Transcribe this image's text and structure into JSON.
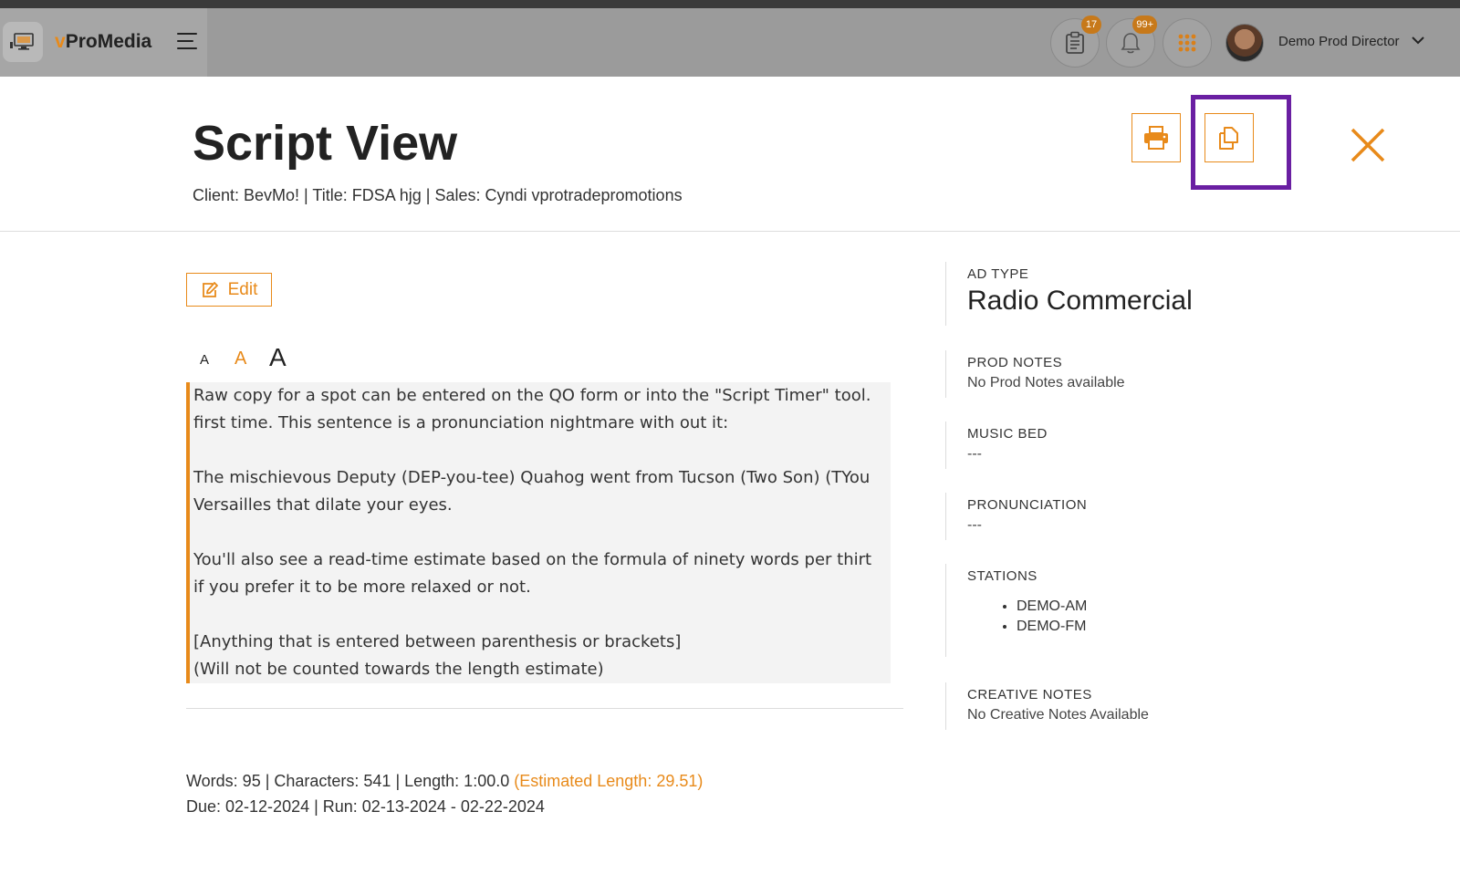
{
  "app": {
    "name_prefix": "v",
    "name_rest": "ProMedia",
    "tasks_badge": "17",
    "notifications_badge": "99+",
    "user_name": "Demo Prod Director"
  },
  "header": {
    "title": "Script View",
    "subtitle": "Client: BevMo! | Title: FDSA hjg | Sales: Cyndi vprotradepromotions"
  },
  "toolbar": {
    "edit_label": "Edit",
    "font_small": "A",
    "font_medium": "A",
    "font_large": "A"
  },
  "script": {
    "lines": [
      "Raw copy for a spot can be entered on the QO form or into the \"Script Timer\" tool.",
      "first time. This sentence is a pronunciation nightmare with out it:",
      "",
      "The mischievous Deputy (DEP-you-tee) Quahog went from Tucson (Two Son) (TYou",
      "Versailles that dilate your eyes.",
      "",
      "You'll also see a read-time estimate based on the formula of ninety words per thirt",
      "if you prefer it to be more relaxed or not.",
      "",
      "[Anything that is entered between parenthesis or brackets]",
      "(Will not be counted towards the length estimate)"
    ]
  },
  "stats": {
    "counts": "Words: 95 | Characters: 541 | Length: 1:00.0 ",
    "estimated": "(Estimated Length: 29.51)",
    "dates": "Due: 02-12-2024 | Run: 02-13-2024 - 02-22-2024"
  },
  "sidebar": {
    "ad_type_label": "AD TYPE",
    "ad_type_value": "Radio Commercial",
    "prod_notes_label": "PROD NOTES",
    "prod_notes_value": "No Prod Notes available",
    "music_bed_label": "MUSIC BED",
    "music_bed_value": "---",
    "pronunciation_label": "PRONUNCIATION",
    "pronunciation_value": "---",
    "stations_label": "STATIONS",
    "stations": [
      "DEMO-AM",
      "DEMO-FM"
    ],
    "creative_notes_label": "CREATIVE NOTES",
    "creative_notes_value": "No Creative Notes Available"
  },
  "colors": {
    "accent": "#e88a1a",
    "highlight": "#6a1fa2",
    "topbar": "#9b9b9b"
  }
}
